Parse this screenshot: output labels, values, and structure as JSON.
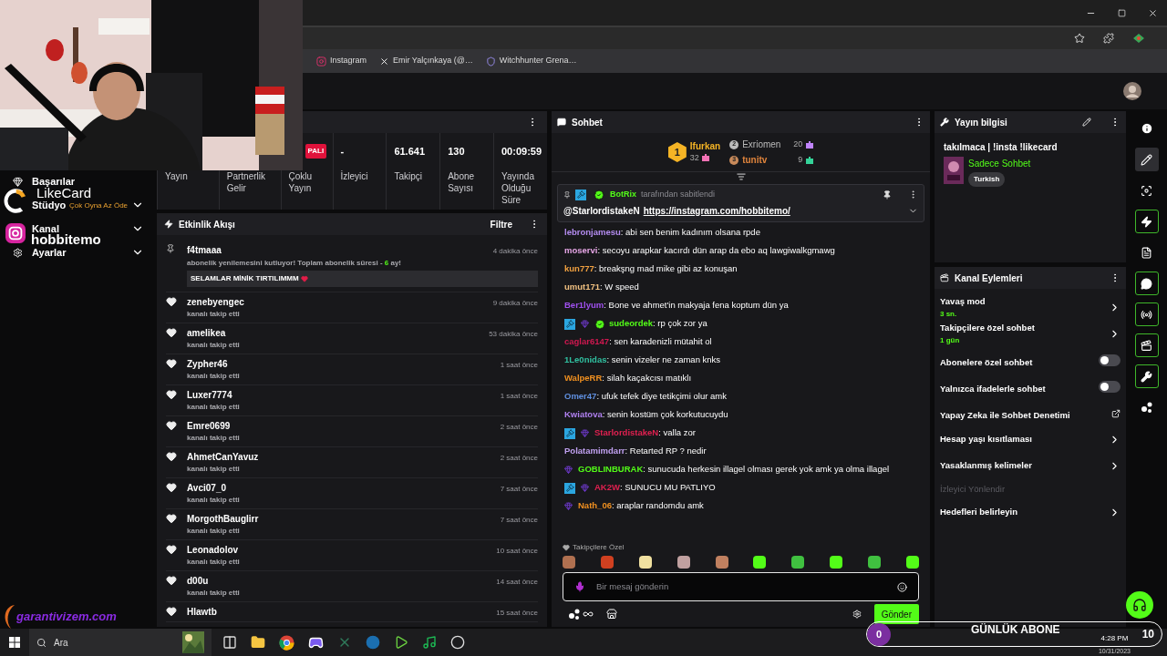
{
  "browser": {
    "bookmarks": [
      {
        "label": "Instagram",
        "kind": "instagram"
      },
      {
        "label": "Emir Yalçınkaya (@…",
        "kind": "x"
      },
      {
        "label": "Witchhunter Grena…",
        "kind": "shield"
      }
    ]
  },
  "sidebar": {
    "items": [
      {
        "label": "Başarılar",
        "kind": "gem",
        "expandable": false
      },
      {
        "label": "Stüdyo",
        "expandable": true
      },
      {
        "label": "Kanal",
        "expandable": true
      },
      {
        "label": "Ayarlar",
        "kind": "gear",
        "expandable": true
      }
    ]
  },
  "stats": {
    "tiles": [
      {
        "label": "Yayın"
      },
      {
        "label": "Partnerlik Gelir"
      },
      {
        "label": "Çoklu Yayın",
        "badge": "PALI"
      },
      {
        "value": "-",
        "label": "İzleyici"
      },
      {
        "value": "61.641",
        "label": "Takipçi"
      },
      {
        "value": "130",
        "label": "Abone Sayısı"
      },
      {
        "value": "00:09:59",
        "label": "Yayında Olduğu Süre"
      }
    ]
  },
  "activity": {
    "title": "Etkinlik Akışı",
    "filter": "Filtre",
    "items": [
      {
        "kind": "subscription",
        "user": "f4tmaaa",
        "time": "4 dakika önce",
        "text": "abonelik yenilemesini kutluyor! Toplam abonelik süresi - ",
        "months": "6",
        "text_end": " ay!",
        "message": "SELAMLAR MİNİK TIRTILIMMM"
      },
      {
        "kind": "follow",
        "user": "zenebyengec",
        "time": "9 dakika önce",
        "action": "kanalı takip etti"
      },
      {
        "kind": "follow",
        "user": "amelikea",
        "time": "53 dakika önce",
        "action": "kanalı takip etti"
      },
      {
        "kind": "follow",
        "user": "Zypher46",
        "time": "1 saat önce",
        "action": "kanalı takip etti"
      },
      {
        "kind": "follow",
        "user": "Luxer7774",
        "time": "1 saat önce",
        "action": "kanalı takip etti"
      },
      {
        "kind": "follow",
        "user": "Emre0699",
        "time": "2 saat önce",
        "action": "kanalı takip etti"
      },
      {
        "kind": "follow",
        "user": "AhmetCanYavuz",
        "time": "2 saat önce",
        "action": "kanalı takip etti"
      },
      {
        "kind": "follow",
        "user": "Avci07_0",
        "time": "7 saat önce",
        "action": "kanalı takip etti"
      },
      {
        "kind": "follow",
        "user": "MorgothBauglirr",
        "time": "7 saat önce",
        "action": "kanalı takip etti"
      },
      {
        "kind": "follow",
        "user": "Leonadolov",
        "time": "10 saat önce",
        "action": "kanalı takip etti"
      },
      {
        "kind": "follow",
        "user": "d00u",
        "time": "14 saat önce",
        "action": "kanalı takip etti"
      },
      {
        "kind": "follow",
        "user": "Hlawtb",
        "time": "15 saat önce"
      }
    ]
  },
  "chat": {
    "title": "Sohbet",
    "leaderboard": [
      {
        "rank": "1",
        "name": "Ifurkan",
        "count": "32",
        "color": "#f472b6"
      },
      {
        "rank": "2",
        "name": "Exriomen",
        "count": "20",
        "color": "#c084fc"
      },
      {
        "rank": "3",
        "name": "tunitv",
        "count": "9",
        "color": "#34d399"
      }
    ],
    "pinned": {
      "moderator": true,
      "verified": true,
      "user": "BotRix",
      "note": "tarafından sabitlendi",
      "mention": "@StarlordistakeN",
      "link": "https://instagram.com/hobbitemo/"
    },
    "messages": [
      {
        "user": "lebronjamesu",
        "color": "#b48cf0",
        "moderator": false,
        "subscriber": false,
        "verified": false,
        "text": ": abi sen benim kadınım olsana rpde"
      },
      {
        "user": "moservi",
        "color": "#e6a6e6",
        "moderator": false,
        "subscriber": false,
        "verified": false,
        "text": ": secoyu arapkar kacırdı dün arap da ebo aq lawgiwalkgmawg"
      },
      {
        "user": "kun777",
        "color": "#f0a040",
        "moderator": false,
        "subscriber": false,
        "verified": false,
        "text": ": breakşng mad mike gibi az konuşan"
      },
      {
        "user": "umut171",
        "color": "#f0c080",
        "moderator": false,
        "subscriber": false,
        "verified": false,
        "text": ": W speed"
      },
      {
        "user": "Ber1lyum",
        "color": "#a050f0",
        "moderator": false,
        "subscriber": false,
        "verified": false,
        "text": ": Bone ve ahmet'in makyaja fena koptum dün ya"
      },
      {
        "user": "sudeordek",
        "color": "#53fc18",
        "moderator": true,
        "subscriber": true,
        "verified": true,
        "text": ": rp çok zor ya"
      },
      {
        "user": "caglar6147",
        "color": "#d01850",
        "moderator": false,
        "subscriber": false,
        "verified": false,
        "text": ": sen karadenizli mütahit ol"
      },
      {
        "user": "1Le0nidas",
        "color": "#30c0a0",
        "moderator": false,
        "subscriber": false,
        "verified": false,
        "text": ": senin vizeler ne zaman knks"
      },
      {
        "user": "WalpeRR",
        "color": "#f09020",
        "moderator": false,
        "subscriber": false,
        "verified": false,
        "text": ": silah kaçakcısı matıklı"
      },
      {
        "user": "Omer47",
        "color": "#6090e0",
        "moderator": false,
        "subscriber": false,
        "verified": false,
        "text": ": ufuk tefek diye tetikçimi olur amk"
      },
      {
        "user": "Kwiatova",
        "color": "#b080f0",
        "moderator": false,
        "subscriber": false,
        "verified": false,
        "text": ": senin kostüm çok korkutucuydu"
      },
      {
        "user": "StarlordistakeN",
        "color": "#e02050",
        "moderator": true,
        "subscriber": true,
        "verified": false,
        "text": ": valla zor"
      },
      {
        "user": "Polatamimdarr",
        "color": "#c0a0f0",
        "moderator": false,
        "subscriber": false,
        "verified": false,
        "text": ": Retarted RP ? nedir"
      },
      {
        "user": "GOBLINBURAK",
        "color": "#53fc18",
        "moderator": false,
        "subscriber": true,
        "verified": false,
        "text": ": sunucuda herkesin illagel olması gerek yok amk ya olma illagel"
      },
      {
        "user": "AK2W",
        "color": "#e02050",
        "moderator": true,
        "subscriber": true,
        "verified": false,
        "text": ": SUNUCU MU PATLIYO"
      },
      {
        "user": "Nath_06",
        "color": "#f09020",
        "moderator": false,
        "subscriber": true,
        "verified": false,
        "text": ": araplar randomdu amk"
      }
    ],
    "emote_section": "Takipçilere Özel",
    "emotes": [
      {
        "color": "#b07050"
      },
      {
        "color": "#d04020"
      },
      {
        "color": "#f0e0a0"
      },
      {
        "color": "#c0a0a0"
      },
      {
        "color": "#c08060"
      },
      {
        "color": "#53fc18"
      },
      {
        "color": "#40c040"
      },
      {
        "color": "#53fc18"
      },
      {
        "color": "#40c040"
      },
      {
        "color": "#53fc18"
      }
    ],
    "input": {
      "placeholder": "Bir mesaj gönderin"
    },
    "send": "Gönder"
  },
  "stream_info": {
    "title": "Yayın bilgisi",
    "stream_title": "takılmaca | !insta !likecard",
    "category": "Sadece Sohbet",
    "tag": "Turkish"
  },
  "channel_actions": {
    "title": "Kanal Eylemleri",
    "items": [
      {
        "kind": "link",
        "label": "Yavaş mod",
        "value": "3 sn."
      },
      {
        "kind": "link",
        "label": "Takipçilere özel sohbet",
        "value": "1 gün"
      },
      {
        "kind": "toggle",
        "label": "Abonelere özel sohbet",
        "on": false
      },
      {
        "kind": "toggle",
        "label": "Yalnızca ifadelerle sohbet",
        "on": false
      },
      {
        "kind": "external",
        "label": "Yapay Zeka ile Sohbet Denetimi"
      },
      {
        "kind": "link",
        "label": "Hesap yaşı kısıtlaması"
      },
      {
        "kind": "link",
        "label": "Yasaklanmış kelimeler"
      },
      {
        "kind": "disabled",
        "label": "İzleyici Yönlendir"
      },
      {
        "kind": "link",
        "label": "Hedefleri belirleyin"
      }
    ]
  },
  "rail": [
    {
      "kind": "info",
      "active": false,
      "selected": false
    },
    {
      "kind": "pencil",
      "active": false,
      "selected": true
    },
    {
      "kind": "focus",
      "active": false,
      "selected": false
    },
    {
      "kind": "bolt",
      "active": true,
      "selected": false
    },
    {
      "kind": "document",
      "active": false,
      "selected": false
    },
    {
      "kind": "chat",
      "active": true,
      "selected": false
    },
    {
      "kind": "broadcast",
      "active": true,
      "selected": false
    },
    {
      "kind": "layout",
      "active": true,
      "selected": false
    },
    {
      "kind": "wrench",
      "active": true,
      "selected": false
    },
    {
      "kind": "dots",
      "active": false,
      "selected": false
    }
  ],
  "overlays": {
    "brand": "LikeCard",
    "brand_slogan": "Çok Oyna Az Öde",
    "instagram": "hobbitemo",
    "sponsor": "garantivizem.com",
    "goal": {
      "label": "GÜNLÜK ABONE",
      "current": "0",
      "target": "10",
      "level": 0
    }
  },
  "taskbar": {
    "search": "Ara",
    "time": "4:28 PM",
    "date": "10/31/2023"
  }
}
